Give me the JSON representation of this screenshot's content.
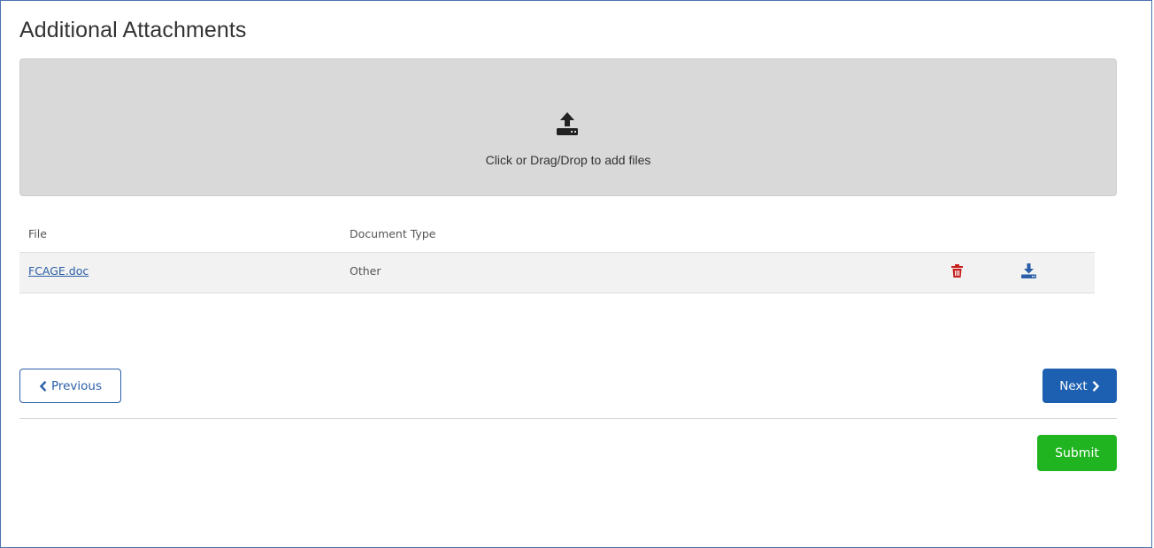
{
  "page": {
    "title": "Additional Attachments"
  },
  "dropzone": {
    "text": "Click or Drag/Drop to add files",
    "icon": "upload-icon"
  },
  "table": {
    "columns": [
      "File",
      "Document Type"
    ],
    "rows": [
      {
        "file": "FCAGE.doc",
        "document_type": "Other",
        "actions": [
          "trash-icon",
          "download-icon"
        ]
      }
    ]
  },
  "navigation": {
    "previous_label": "Previous",
    "next_label": "Next",
    "submit_label": "Submit"
  },
  "colors": {
    "link": "#2b5ea7",
    "next_button": "#1d5fb0",
    "submit_button": "#20b520",
    "delete_icon": "#c81e1e",
    "dropzone_bg": "#d9d9d9"
  }
}
